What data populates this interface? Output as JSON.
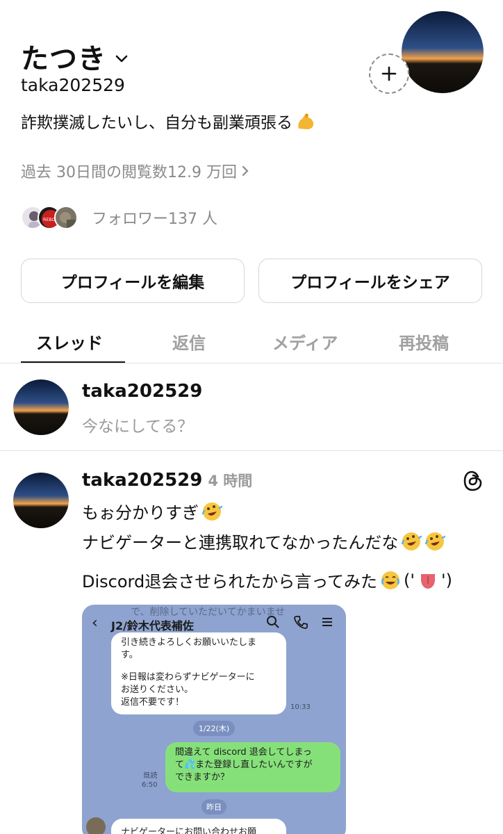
{
  "profile": {
    "display_name": "たつき",
    "handle": "taka202529",
    "bio": "詐欺撲滅したいし、自分も副業頑張る",
    "bio_emoji": "flexed-biceps",
    "views_text": "過去 30日間の閲覧数12.9 万回",
    "followers_text": "フォロワー137 人",
    "follower_avatars": [
      "follower-avatar-1",
      "follower-avatar-2",
      "follower-avatar-3"
    ],
    "follower_avatar_label": "REBOO"
  },
  "buttons": {
    "edit_profile": "プロフィールを編集",
    "share_profile": "プロフィールをシェア"
  },
  "tabs": [
    {
      "label": "スレッド",
      "active": true
    },
    {
      "label": "返信",
      "active": false
    },
    {
      "label": "メディア",
      "active": false
    },
    {
      "label": "再投稿",
      "active": false
    }
  ],
  "composer": {
    "username": "taka202529",
    "placeholder": "今なにしてる？"
  },
  "post": {
    "username": "taka202529",
    "time": "4 時間",
    "lines": [
      {
        "text": "もぉ分かりすぎ",
        "emojis": [
          "rolling-on-floor-laughing"
        ]
      },
      {
        "text": "ナビゲーターと連携取れてなかったんだな",
        "emojis": [
          "rolling-on-floor-laughing",
          "rolling-on-floor-laughing"
        ]
      },
      {
        "text": "Discord退会させられたから言ってみた",
        "emojis": [
          "face-with-tears-of-joy"
        ],
        "suffix_before": "('",
        "suffix_after": "')",
        "mid_emoji": "tongue"
      }
    ]
  },
  "embedded_chat": {
    "ghost_text": "で、削除していただいてかまいませ",
    "title": "J2/鈴木代表補佐",
    "white_bubble_lines": [
      "引き続きよろしくお願いいたしま",
      "す。",
      "",
      "※日報は変わらずナビゲーターに",
      "お送りください。",
      "返信不要です！"
    ],
    "white_bubble_time": "10:33",
    "date1": "1/22(木)",
    "green_bubble_lines": [
      "間違えて discord 退会してしまっ",
      "て💦また登録し直したいんですが",
      "できますか？"
    ],
    "read_label": "既読",
    "read_time": "6:50",
    "date2": "昨日",
    "last_bubble": "ナビゲーターにお問い合わせお願"
  },
  "colors": {
    "accent_text": "#111111",
    "muted_text": "#8a8a8a",
    "chat_bg": "#8ea3cf",
    "green_bubble": "#86e07a"
  }
}
